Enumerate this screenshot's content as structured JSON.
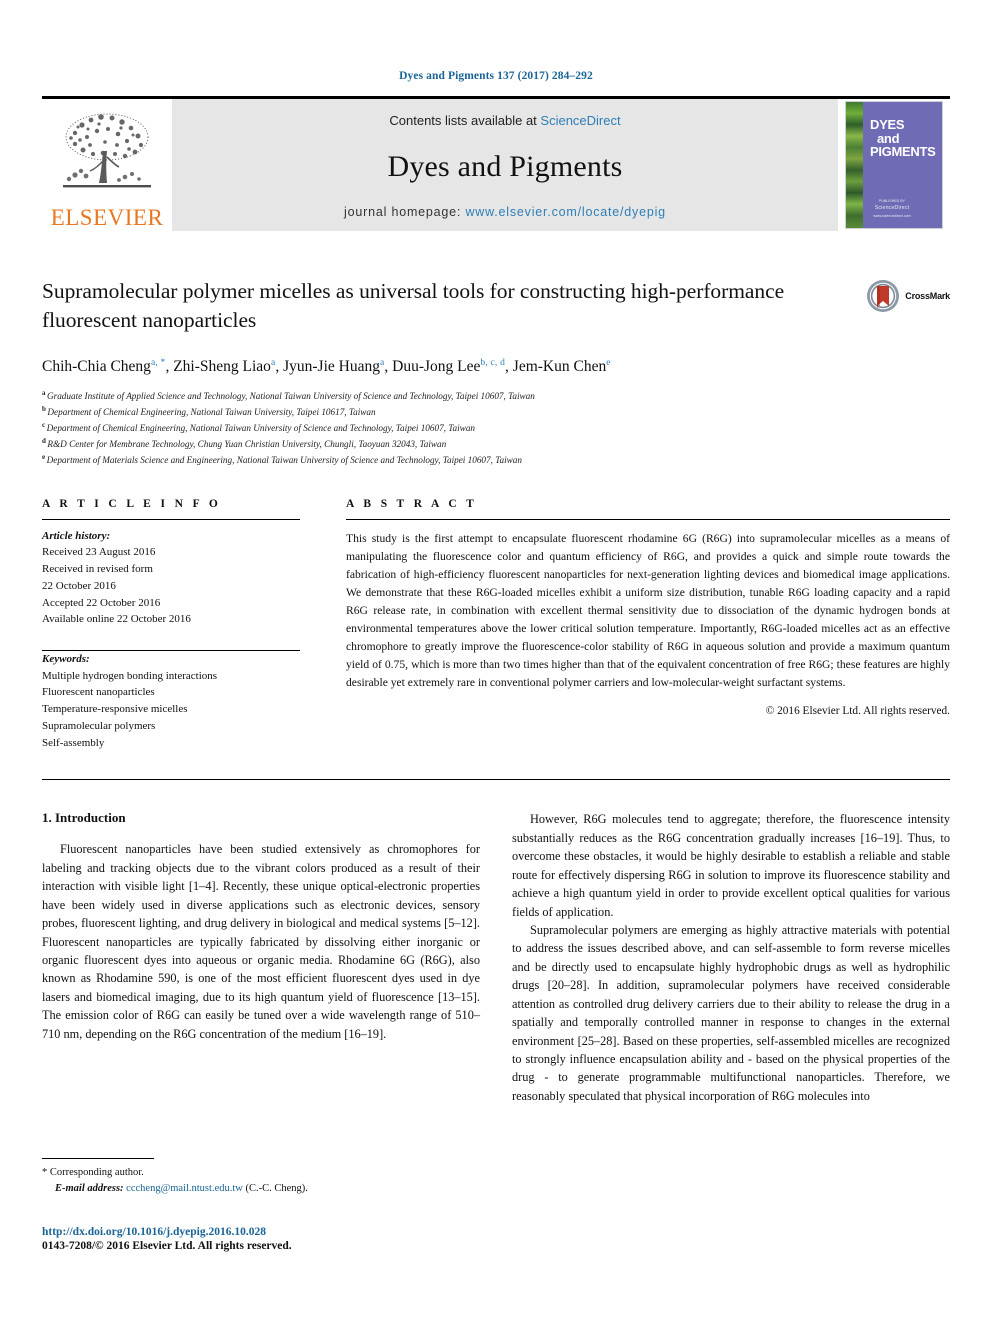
{
  "running_head": "Dyes and Pigments 137 (2017) 284–292",
  "masthead": {
    "publisher_name": "ELSEVIER",
    "contents_prefix": "Contents lists available at ",
    "contents_link": "ScienceDirect",
    "journal_title": "Dyes and Pigments",
    "homepage_label": "journal homepage: ",
    "homepage_url": "www.elsevier.com/locate/dyepig",
    "cover": {
      "line1": "DYES",
      "line2": "and",
      "line3": "PIGMENTS",
      "footer_top": "PUBLISHED BY",
      "footer_brand": "ScienceDirect",
      "footer_sub": "www.sciencedirect.com"
    }
  },
  "article": {
    "title": "Supramolecular polymer micelles as universal tools for constructing high-performance fluorescent nanoparticles",
    "crossmark_label": "CrossMark",
    "authors_html": "Chih-Chia Cheng <sup>a, *</sup>, Zhi-Sheng Liao <sup>a</sup>, Jyun-Jie Huang <sup>a</sup>, Duu-Jong Lee <sup>b, c, d</sup>, Jem-Kun Chen <sup>e</sup>",
    "authors": [
      {
        "name": "Chih-Chia Cheng",
        "marks": "a, *"
      },
      {
        "name": "Zhi-Sheng Liao",
        "marks": "a"
      },
      {
        "name": "Jyun-Jie Huang",
        "marks": "a"
      },
      {
        "name": "Duu-Jong Lee",
        "marks": "b, c, d"
      },
      {
        "name": "Jem-Kun Chen",
        "marks": "e"
      }
    ],
    "affiliations": [
      {
        "mark": "a",
        "text": "Graduate Institute of Applied Science and Technology, National Taiwan University of Science and Technology, Taipei 10607, Taiwan"
      },
      {
        "mark": "b",
        "text": "Department of Chemical Engineering, National Taiwan University, Taipei 10617, Taiwan"
      },
      {
        "mark": "c",
        "text": "Department of Chemical Engineering, National Taiwan University of Science and Technology, Taipei 10607, Taiwan"
      },
      {
        "mark": "d",
        "text": "R&D Center for Membrane Technology, Chung Yuan Christian University, Chungli, Taoyuan 32043, Taiwan"
      },
      {
        "mark": "e",
        "text": "Department of Materials Science and Engineering, National Taiwan University of Science and Technology, Taipei 10607, Taiwan"
      }
    ]
  },
  "article_info": {
    "heading": "A R T I C L E   I N F O",
    "history_label": "Article history:",
    "history": [
      "Received 23 August 2016",
      "Received in revised form",
      "22 October 2016",
      "Accepted 22 October 2016",
      "Available online 22 October 2016"
    ],
    "keywords_label": "Keywords:",
    "keywords": [
      "Multiple hydrogen bonding interactions",
      "Fluorescent nanoparticles",
      "Temperature-responsive micelles",
      "Supramolecular polymers",
      "Self-assembly"
    ]
  },
  "abstract": {
    "heading": "A B S T R A C T",
    "text": "This study is the first attempt to encapsulate fluorescent rhodamine 6G (R6G) into supramolecular micelles as a means of manipulating the fluorescence color and quantum efficiency of R6G, and provides a quick and simple route towards the fabrication of high-efficiency fluorescent nanoparticles for next-generation lighting devices and biomedical image applications. We demonstrate that these R6G-loaded micelles exhibit a uniform size distribution, tunable R6G loading capacity and a rapid R6G release rate, in combination with excellent thermal sensitivity due to dissociation of the dynamic hydrogen bonds at environmental temperatures above the lower critical solution temperature. Importantly, R6G-loaded micelles act as an effective chromophore to greatly improve the fluorescence-color stability of R6G in aqueous solution and provide a maximum quantum yield of 0.75, which is more than two times higher than that of the equivalent concentration of free R6G; these features are highly desirable yet extremely rare in conventional polymer carriers and low-molecular-weight surfactant systems.",
    "copyright": "© 2016 Elsevier Ltd. All rights reserved."
  },
  "body": {
    "section_number_title": "1. Introduction",
    "left_paragraphs": [
      "Fluorescent nanoparticles have been studied extensively as chromophores for labeling and tracking objects due to the vibrant colors produced as a result of their interaction with visible light [1–4]. Recently, these unique optical-electronic properties have been widely used in diverse applications such as electronic devices, sensory probes, fluorescent lighting, and drug delivery in biological and medical systems [5–12]. Fluorescent nanoparticles are typically fabricated by dissolving either inorganic or organic fluorescent dyes into aqueous or organic media. Rhodamine 6G (R6G), also known as Rhodamine 590, is one of the most efficient fluorescent dyes used in dye lasers and biomedical imaging, due to its high quantum yield of fluorescence [13–15]. The emission color of R6G can easily be tuned over a wide wavelength range of 510–710 nm, depending on the R6G concentration of the medium [16–19]."
    ],
    "right_paragraphs": [
      "However, R6G molecules tend to aggregate; therefore, the fluorescence intensity substantially reduces as the R6G concentration gradually increases [16–19]. Thus, to overcome these obstacles, it would be highly desirable to establish a reliable and stable route for effectively dispersing R6G in solution to improve its fluorescence stability and achieve a high quantum yield in order to provide excellent optical qualities for various fields of application.",
      "Supramolecular polymers are emerging as highly attractive materials with potential to address the issues described above, and can self-assemble to form reverse micelles and be directly used to encapsulate highly hydrophobic drugs as well as hydrophilic drugs [20–28]. In addition, supramolecular polymers have received considerable attention as controlled drug delivery carriers due to their ability to release the drug in a spatially and temporally controlled manner in response to changes in the external environment [25–28]. Based on these properties, self-assembled micelles are recognized to strongly influence encapsulation ability and - based on the physical properties of the drug - to generate programmable multifunctional nanoparticles. Therefore, we reasonably speculated that physical incorporation of R6G molecules into"
    ]
  },
  "footnote": {
    "corresponding_author": "* Corresponding author.",
    "email_label": "E-mail address:",
    "email": "cccheng@mail.ntust.edu.tw",
    "email_suffix": "(C.-C. Cheng).",
    "doi": "http://dx.doi.org/10.1016/j.dyepig.2016.10.028",
    "issn_line": "0143-7208/© 2016 Elsevier Ltd. All rights reserved."
  },
  "colors": {
    "link_blue": "#1a6496",
    "science_direct_blue": "#2e7eb8",
    "elsevier_orange": "#E87722",
    "cover_purple": "#6f6bb5",
    "crossmark_red": "#c0392b"
  }
}
